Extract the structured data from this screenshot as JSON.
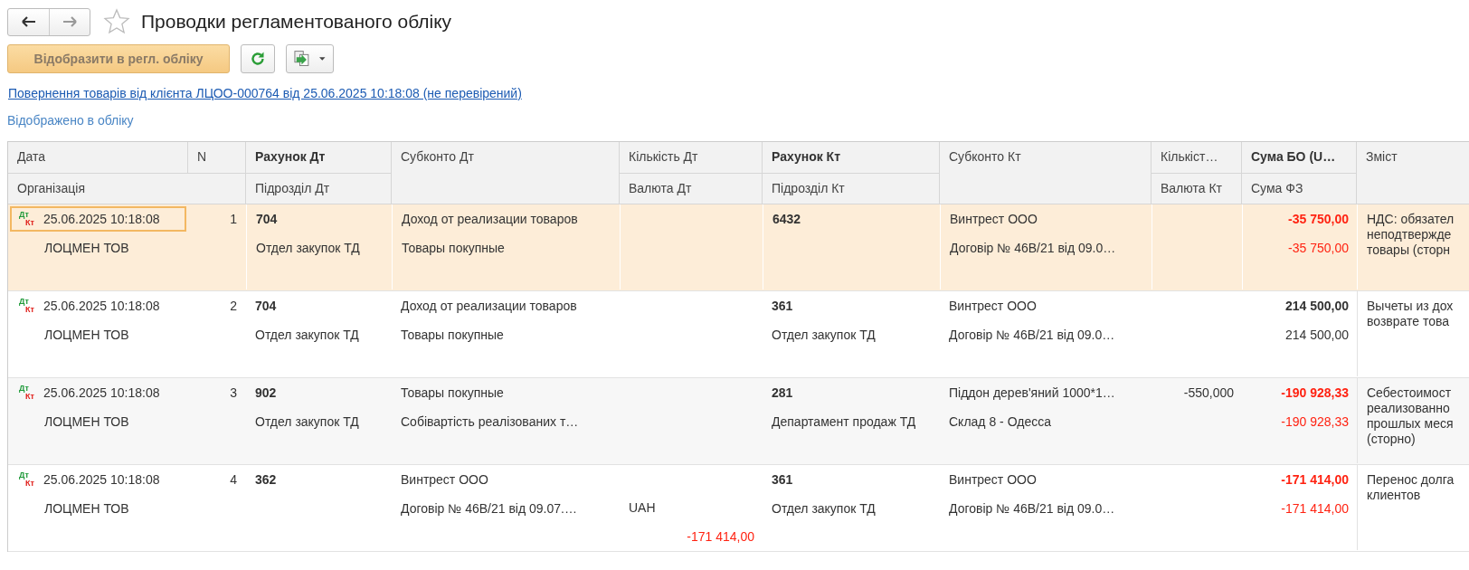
{
  "window": {
    "title": "Проводки регламентованого обліку"
  },
  "toolbar": {
    "post_button": "Відобразити в регл. обліку"
  },
  "document_link": "Повернення товарів від клієнта ЛЦОО-000764 від 25.06.2025 10:18:08 (не перевірений)",
  "status": "Відображено в обліку",
  "table": {
    "header": {
      "date": "Дата",
      "n": "N",
      "organization": "Організація",
      "columns": [
        {
          "label": "Рахунок Дт",
          "sublabel": "Підрозділ Дт",
          "bold": true
        },
        {
          "label": "Субконто Дт",
          "bold": false
        },
        {
          "label": "Кількість Дт",
          "sublabel": "Валюта Дт",
          "bold": false
        },
        {
          "label": "Рахунок Кт",
          "sublabel": "Підрозділ Кт",
          "bold": true
        },
        {
          "label": "Субконто Кт",
          "bold": false
        },
        {
          "label": "Кількіст…",
          "sublabel": "Валюта Кт",
          "bold": false
        },
        {
          "label": "Сума БО (U…",
          "sublabel": "Сума ФЗ",
          "bold": true
        },
        {
          "label": "Зміст",
          "bold": false
        }
      ]
    },
    "rows": [
      {
        "selected": true,
        "mark_dt": "Дт",
        "mark_kt": "Кт",
        "date": "25.06.2025 10:18:08",
        "n": "1",
        "organization": "ЛОЦМЕН ТОВ",
        "account_dt": "704",
        "dept_dt": "Отдел закупок ТД",
        "subconto_dt": [
          "Доход от реализации товаров",
          "Товары покупные"
        ],
        "account_kt": "6432",
        "subconto_kt": [
          "Винтрест ООО",
          "Договір № 46В/21 від 09.0…"
        ],
        "sum_bo": "-35 750,00",
        "sum_fz": "-35 750,00",
        "negative": true,
        "content": [
          "НДС: обязател",
          "неподтвержде",
          "товары (сторн"
        ]
      },
      {
        "selected": false,
        "mark_dt": "Дт",
        "mark_kt": "Кт",
        "date": "25.06.2025 10:18:08",
        "n": "2",
        "organization": "ЛОЦМЕН ТОВ",
        "account_dt": "704",
        "dept_dt": "Отдел закупок ТД",
        "subconto_dt": [
          "Доход от реализации товаров",
          "Товары покупные"
        ],
        "account_kt": "361",
        "dept_kt": "Отдел закупок ТД",
        "subconto_kt": [
          "Винтрест ООО",
          "Договір № 46В/21 від 09.0…"
        ],
        "sum_bo": "214 500,00",
        "sum_fz": "214 500,00",
        "negative": false,
        "content": [
          "Вычеты из дох",
          "возврате това"
        ]
      },
      {
        "selected": false,
        "mark_dt": "Дт",
        "mark_kt": "Кт",
        "date": "25.06.2025 10:18:08",
        "n": "3",
        "organization": "ЛОЦМЕН ТОВ",
        "account_dt": "902",
        "dept_dt": "Отдел закупок ТД",
        "subconto_dt": [
          "Товары покупные",
          "Собівартість реалізованих т…"
        ],
        "account_kt": "281",
        "dept_kt": "Департамент продаж ТД",
        "subconto_kt": [
          "Піддон дерев'яний 1000*1…",
          "Склад 8 - Одесса"
        ],
        "qty_kt": "-550,000",
        "sum_bo": "-190 928,33",
        "sum_fz": "-190 928,33",
        "negative": true,
        "content": [
          "Себестоимост",
          "реализованно",
          "прошлых меся",
          "(сторно)"
        ]
      },
      {
        "selected": false,
        "mark_dt": "Дт",
        "mark_kt": "Кт",
        "date": "25.06.2025 10:18:08",
        "n": "4",
        "organization": "ЛОЦМЕН ТОВ",
        "account_dt": "362",
        "subconto_dt": [
          "Винтрест ООО",
          "Договір № 46В/21 від 09.07.…"
        ],
        "currency_dt": "UAH",
        "amount_cur_dt": "-171 414,00",
        "account_kt": "361",
        "dept_kt": "Отдел закупок ТД",
        "subconto_kt": [
          "Винтрест ООО",
          "Договір № 46В/21 від 09.0…"
        ],
        "sum_bo": "-171 414,00",
        "sum_fz": "-171 414,00",
        "negative": true,
        "content": [
          "Перенос долга",
          "клиентов"
        ]
      }
    ]
  }
}
